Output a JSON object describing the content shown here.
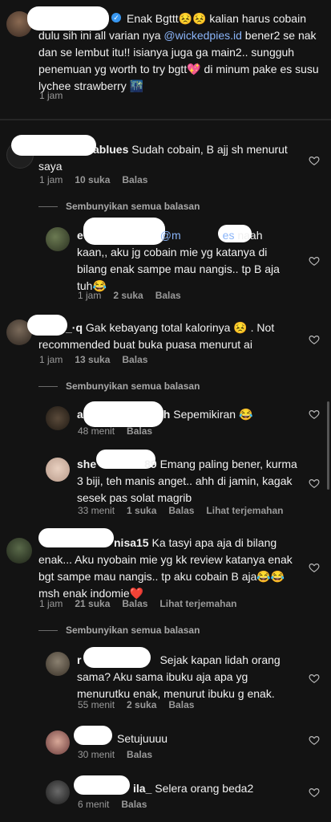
{
  "comments": [
    {
      "user": "",
      "text": "Enak Bgttt😣😣 kalian harus cobain dulu sih ini all varian nya ",
      "mention": "@wickedpies.id",
      "text2": " bener2 se nak dan se lembut itu!! isianya juga ga main2.. sungguh penemuan yg worth to try bgtt💖 di minum pake es susu lychee strawberry 🌃",
      "time": "1 jam"
    },
    {
      "user": "ablues",
      "text": "Sudah cobain, B ajj sh menurut saya",
      "time": "1 jam",
      "likes": "10 suka",
      "reply": "Balas",
      "hide": "Sembunyikan semua balasan"
    },
    {
      "user": "e",
      "mention": "@m",
      "mention_end": "es",
      "text": " naah kaan,, aku jg cobain mie yg katanya di bilang enak sampe mau nangis.. tp B aja tuh😂",
      "time": "1 jam",
      "likes": "2 suka",
      "reply": "Balas"
    },
    {
      "user": "_·q",
      "text": "Gak kebayang total kalorinya 😣 . Not recommended buat buka puasa menurut ai",
      "time": "1 jam",
      "likes": "13 suka",
      "reply": "Balas",
      "hide": "Sembunyikan semua balasan"
    },
    {
      "user": "a",
      "user_end": "h",
      "text": "Sepemikiran 😂",
      "time": "48 menit",
      "reply": "Balas"
    },
    {
      "user": "she",
      "user_end": "89",
      "text": "Emang paling bener, kurma 3 biji, teh manis anget.. ahh di jamin, kagak sesek pas solat magrib",
      "time": "33 menit",
      "likes": "1 suka",
      "reply": "Balas",
      "translate": "Lihat terjemahan"
    },
    {
      "user": "nisa15",
      "text": "Ka tasyi apa aja di bilang enak... Aku nyobain mie yg kk review katanya enak bgt sampe mau nangis.. tp aku cobain B aja😂😂 msh enak indomie❤️",
      "time": "1 jam",
      "likes": "21 suka",
      "reply": "Balas",
      "translate": "Lihat terjemahan",
      "hide": "Sembunyikan semua balasan"
    },
    {
      "user": "r",
      "text": "Sejak kapan lidah orang sama? Aku sama ibuku aja apa yg menurutku enak, menurut ibuku g enak.",
      "time": "55 menit",
      "likes": "2 suka",
      "reply": "Balas"
    },
    {
      "user": "",
      "text": "Setujuuuu",
      "time": "30 menit",
      "reply": "Balas"
    },
    {
      "user": "ila_",
      "text": "Selera orang beda2",
      "time": "6 menit",
      "reply": "Balas"
    }
  ],
  "colors": {
    "background": "#131313",
    "mention": "#8ab4f8",
    "meta": "#9a9a9a",
    "verified": "#3897f0"
  },
  "icons": {
    "like": "heart-outline-icon",
    "verified": "verified-badge-icon"
  }
}
